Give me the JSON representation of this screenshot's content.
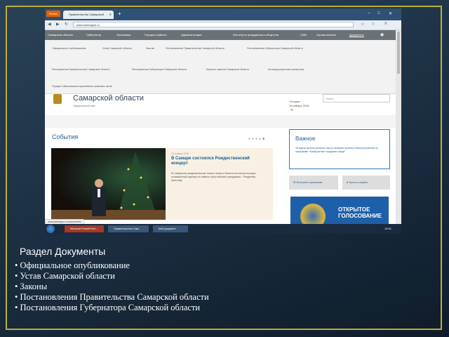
{
  "browser": {
    "menu_button": "Firefox",
    "tab_title": "Правительство Самарской",
    "new_tab": "+",
    "url": "www.samregion.ru"
  },
  "site": {
    "nav": [
      "Самарская область",
      "Губернатор",
      "Экономика",
      "Города и районы",
      "Администрация",
      "Институты гражданского общества",
      "СМИ",
      "Органы власти",
      "Документы"
    ],
    "dropdown": [
      "Официальное опубликование",
      "Устав Самарской области",
      "Законы",
      "Постановления Правительства Самарской области",
      "Постановления Губернатора Самарской области",
      "Распоряжения Правительства Самарской области",
      "Распоряжения Губернатора Самарской области",
      "Проекты законов Самарской области",
      "Антикоррупционная экспертиза",
      "Порядок обжалования нормативных правовых актов"
    ],
    "title": "Самарской области",
    "subtitle": "Официальный сайт",
    "today_label": "Сегодня",
    "date": "16 января 2018",
    "search_placeholder": "Найти...",
    "events": {
      "heading": "События",
      "date": "15 января 2018",
      "title": "В Самаре состоялся Рождественский концерт",
      "text": "В Самарском академическом театре оперы и балета состоялся концерт, посвященный одному из главных христианских праздников - Рождеству Христову."
    },
    "important": {
      "heading": "Важное",
      "text": "18 марта жители региона смогут выбрать проекты благоустройства по программе \"Комфортная городская среда\""
    },
    "reception_button": "Интернет-приемная",
    "press_button": "Пресс-служба",
    "banner_text": "ОТКРЫТОЕ ГОЛОСОВАНИЕ",
    "status_url": "www.samregion.ru/documents/"
  },
  "taskbar": {
    "items": [
      "Microsoft PowerPoint ...",
      "Правительство Сам...",
      "Мой документ"
    ],
    "clock": "15:51"
  },
  "caption": {
    "title": "Раздел Документы",
    "items": [
      "Официальное опубликование",
      "Устав Самарской области",
      "Законы",
      "Постановления Правительства Самарской области",
      "Постановления Губернатора Самарской области"
    ]
  }
}
